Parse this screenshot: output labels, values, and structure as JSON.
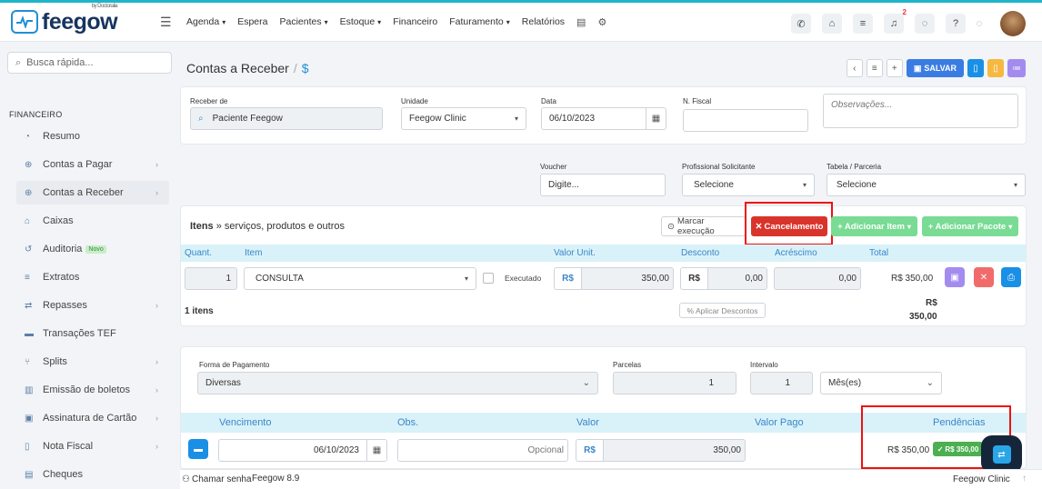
{
  "topbar": {
    "logo_text": "feegow",
    "logo_by": "by Doctoralia",
    "nav": [
      {
        "label": "Agenda",
        "dropdown": true
      },
      {
        "label": "Espera",
        "dropdown": false
      },
      {
        "label": "Pacientes",
        "dropdown": true
      },
      {
        "label": "Estoque",
        "dropdown": true
      },
      {
        "label": "Financeiro",
        "dropdown": false
      },
      {
        "label": "Faturamento",
        "dropdown": true
      },
      {
        "label": "Relatórios",
        "dropdown": false
      }
    ],
    "notification_count": "2",
    "accent_color": "#1fb5c9"
  },
  "sidebar": {
    "search_placeholder": "Busca rápida...",
    "heading": "FINANCEIRO",
    "items": [
      {
        "label": "Resumo",
        "icon": "chart-icon"
      },
      {
        "label": "Contas a Pagar",
        "icon": "plus-circle-icon"
      },
      {
        "label": "Contas a Receber",
        "icon": "plus-circle-icon"
      },
      {
        "label": "Caixas",
        "icon": "inbox-icon"
      },
      {
        "label": "Auditoria",
        "icon": "history-icon",
        "badge": "Novo"
      },
      {
        "label": "Extratos",
        "icon": "list-icon"
      },
      {
        "label": "Repasses",
        "icon": "transfer-icon"
      },
      {
        "label": "Transações TEF",
        "icon": "card-icon"
      },
      {
        "label": "Splits",
        "icon": "split-icon"
      },
      {
        "label": "Emissão de boletos",
        "icon": "barcode-icon"
      },
      {
        "label": "Assinatura de Cartão",
        "icon": "card-sign-icon"
      },
      {
        "label": "Nota Fiscal",
        "icon": "document-icon"
      },
      {
        "label": "Cheques",
        "icon": "cheque-icon"
      }
    ]
  },
  "page": {
    "title": "Contas a Receber",
    "title_symbol": "$",
    "save_label": "SALVAR"
  },
  "form1": {
    "receber_label": "Receber de",
    "receber_value": "Paciente Feegow",
    "unidade_label": "Unidade",
    "unidade_value": "Feegow Clinic",
    "data_label": "Data",
    "data_value": "06/10/2023",
    "nfiscal_label": "N. Fiscal",
    "obs_placeholder": "Observações...",
    "voucher_label": "Voucher",
    "voucher_placeholder": "Digite...",
    "prof_label": "Profissional Solicitante",
    "prof_value": "Selecione",
    "tabela_label": "Tabela / Parceria",
    "tabela_value": "Selecione"
  },
  "items": {
    "title_bold": "Itens",
    "title_rest": " » serviços, produtos e outros",
    "marcar_label": "Marcar execução",
    "cancel_label": "Cancelamento",
    "add_item_label": "+ Adicionar Item",
    "add_pacote_label": "+ Adicionar Pacote",
    "headers": [
      "Quant.",
      "Item",
      "Valor Unit.",
      "Desconto",
      "Acréscimo",
      "Total"
    ],
    "row": {
      "qty": "1",
      "item": "CONSULTA",
      "executado": "Executado",
      "currency": "R$",
      "valor_unit": "350,00",
      "desconto": "0,00",
      "acrescimo": "0,00",
      "total": "R$ 350,00"
    },
    "count": "1 itens",
    "aplicar_label": "Aplicar Descontos",
    "sum_currency": "R$",
    "sum_value": "350,00"
  },
  "payment": {
    "forma_label": "Forma de Pagamento",
    "forma_value": "Diversas",
    "parcelas_label": "Parcelas",
    "parcelas_value": "1",
    "intervalo_label": "Intervalo",
    "intervalo_value": "1",
    "periodo_value": "Mês(es)",
    "headers": [
      "Vencimento",
      "Obs.",
      "Valor",
      "Valor Pago",
      "Pendências"
    ],
    "row": {
      "date": "06/10/2023",
      "obs_placeholder": "Opcional",
      "currency": "R$",
      "valor": "350,00",
      "pendencia": "R$ 350,00",
      "pendencia_tag": "R$ 350,00"
    }
  },
  "footer": {
    "chamar_label": "Chamar senha",
    "version": "Feegow 8.9",
    "clinic": "Feegow Clinic"
  }
}
